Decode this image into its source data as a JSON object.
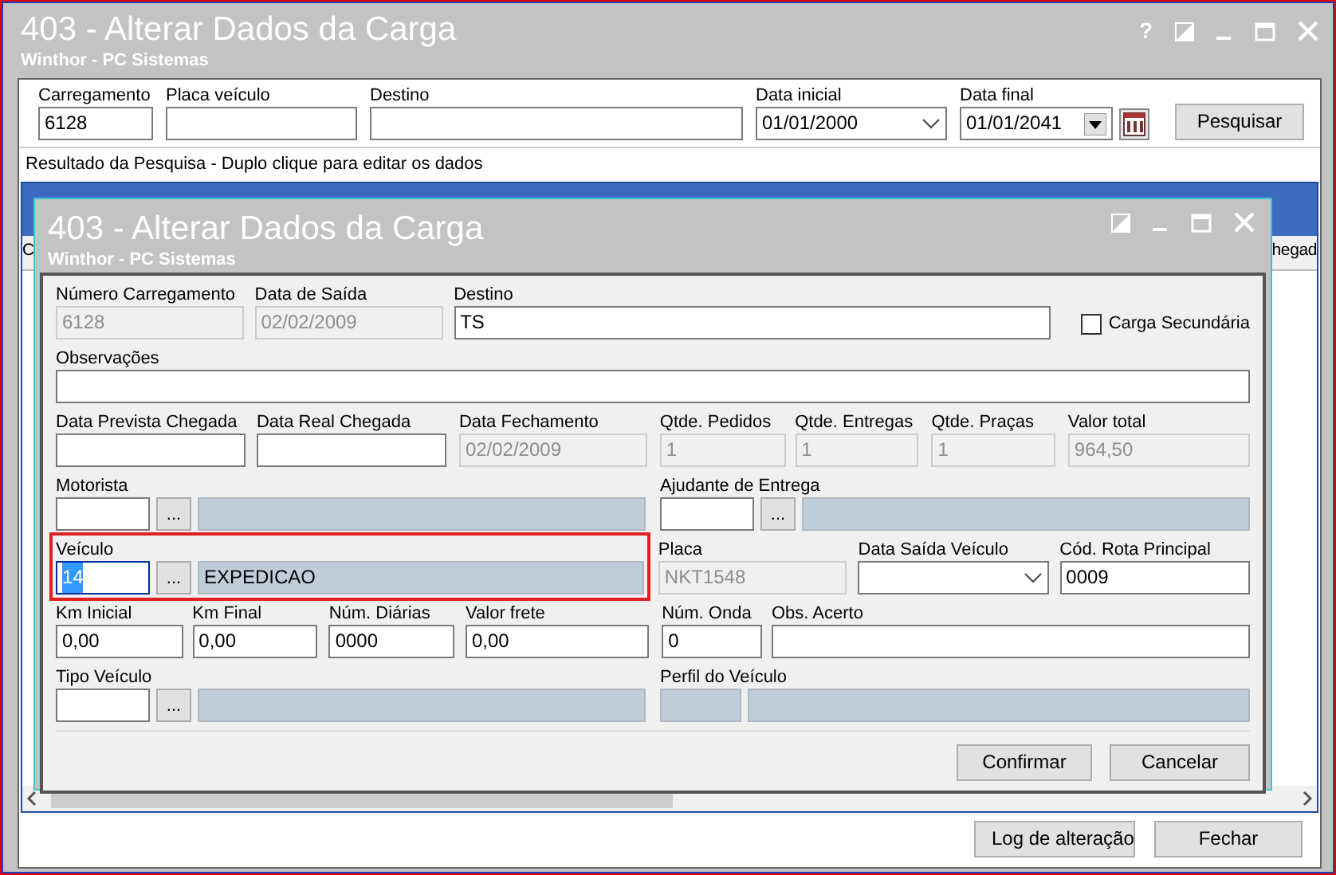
{
  "window": {
    "title": "403 - Alterar Dados da Carga",
    "subtitle": "Winthor - PC Sistemas",
    "help": "?"
  },
  "filters": [
    {
      "kind": "text",
      "label": "Carregamento",
      "value": "6128"
    },
    {
      "kind": "text",
      "label": "Placa veículo"
    },
    {
      "kind": "text",
      "label": "Destino"
    },
    {
      "kind": "combo",
      "label": "Data inicial",
      "value": "01/01/2000"
    },
    {
      "kind": "date_picker",
      "label": "Data final",
      "value": "01/01/2041"
    }
  ],
  "search_button": "Pesquisar",
  "results_label": "Resultado da Pesquisa - Duplo clique para editar os dados",
  "grid": {
    "column_fragments": [
      "C",
      "hegad"
    ]
  },
  "dialog": {
    "title": "403 - Alterar Dados da Carga",
    "subtitle": "Winthor - PC Sistemas",
    "rows": [
      {
        "fields": [
          {
            "kind": "text",
            "label": "Número Carregamento",
            "value": "6128",
            "disabled": true
          },
          {
            "kind": "text",
            "label": "Data de Saída",
            "value": "02/02/2009",
            "disabled": true
          },
          {
            "kind": "text",
            "label": "Destino",
            "value": "TS",
            "disabled": false
          },
          {
            "kind": "checkbox",
            "label": "Carga Secundária",
            "checked": false
          }
        ]
      },
      {
        "fields": [
          {
            "kind": "text",
            "label": "Observações",
            "disabled": false
          }
        ]
      },
      {
        "fields": [
          {
            "kind": "text",
            "label": "Data Prevista Chegada",
            "disabled": false
          },
          {
            "kind": "text",
            "label": "Data Real Chegada",
            "disabled": false
          },
          {
            "kind": "text",
            "label": "Data Fechamento",
            "value": "02/02/2009",
            "disabled": true
          },
          {
            "kind": "text",
            "label": "Qtde. Pedidos",
            "value": "1",
            "disabled": true
          },
          {
            "kind": "text",
            "label": "Qtde. Entregas",
            "value": "1",
            "disabled": true
          },
          {
            "kind": "text",
            "label": "Qtde. Praças",
            "value": "1",
            "disabled": true
          },
          {
            "kind": "text",
            "label": "Valor total",
            "value": "964,50",
            "disabled": true
          }
        ]
      },
      {
        "fields": [
          {
            "kind": "lookup",
            "label": "Motorista",
            "button": "..."
          },
          {
            "kind": "lookup",
            "label": "Ajudante de Entrega",
            "button": "..."
          }
        ]
      },
      {
        "fields": [
          {
            "kind": "lookup",
            "label": "Veículo",
            "code": "14",
            "button": "...",
            "description": "EXPEDICAO",
            "highlighted": true,
            "focused": true
          },
          {
            "kind": "text",
            "label": "Placa",
            "value": "NKT1548",
            "disabled": true
          },
          {
            "kind": "combo",
            "label": "Data Saída Veículo"
          },
          {
            "kind": "text",
            "label": "Cód. Rota Principal",
            "value": "0009",
            "disabled": false
          }
        ]
      },
      {
        "fields": [
          {
            "kind": "text",
            "label": "Km Inicial",
            "value": "0,00",
            "disabled": false
          },
          {
            "kind": "text",
            "label": "Km Final",
            "value": "0,00",
            "disabled": false
          },
          {
            "kind": "text",
            "label": "Núm. Diárias",
            "value": "0000",
            "disabled": false
          },
          {
            "kind": "text",
            "label": "Valor frete",
            "value": "0,00",
            "disabled": false
          },
          {
            "kind": "text",
            "label": "Núm. Onda",
            "value": "0",
            "disabled": false
          },
          {
            "kind": "text",
            "label": "Obs. Acerto",
            "disabled": false
          }
        ]
      },
      {
        "fields": [
          {
            "kind": "lookup",
            "label": "Tipo Veículo",
            "button": "..."
          },
          {
            "kind": "pair",
            "label": "Perfil  do Veículo"
          }
        ]
      }
    ],
    "buttons": [
      "Confirmar",
      "Cancelar"
    ]
  },
  "footer_buttons": [
    "Log de alteração",
    "Fechar"
  ]
}
